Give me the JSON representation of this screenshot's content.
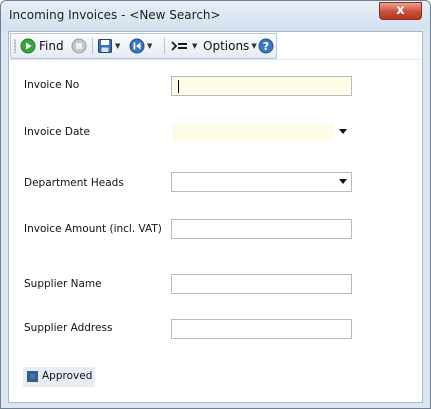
{
  "window": {
    "title": "Incoming Invoices - <New Search>",
    "close_glyph": "x"
  },
  "toolbar": {
    "find_label": "Find",
    "options_label": "Options",
    "icons": [
      "find-icon",
      "stop-icon",
      "save-icon",
      "navigate-icon",
      "actions-icon",
      "help-icon"
    ]
  },
  "form": {
    "invoice_no_label": "Invoice No",
    "invoice_no_value": "",
    "invoice_date_label": "Invoice Date",
    "invoice_date_value": "",
    "department_heads_label": "Department Heads",
    "department_heads_value": "",
    "invoice_amount_label": "Invoice Amount (incl. VAT)",
    "invoice_amount_value": "",
    "supplier_name_label": "Supplier Name",
    "supplier_name_value": "",
    "supplier_address_label": "Supplier Address",
    "supplier_address_value": "",
    "approved_label": "Approved",
    "approved_checked": true
  },
  "colors": {
    "required_field_bg": "#fefbe6",
    "window_frame": "#dbe6f3",
    "close_button": "#c7503a"
  }
}
